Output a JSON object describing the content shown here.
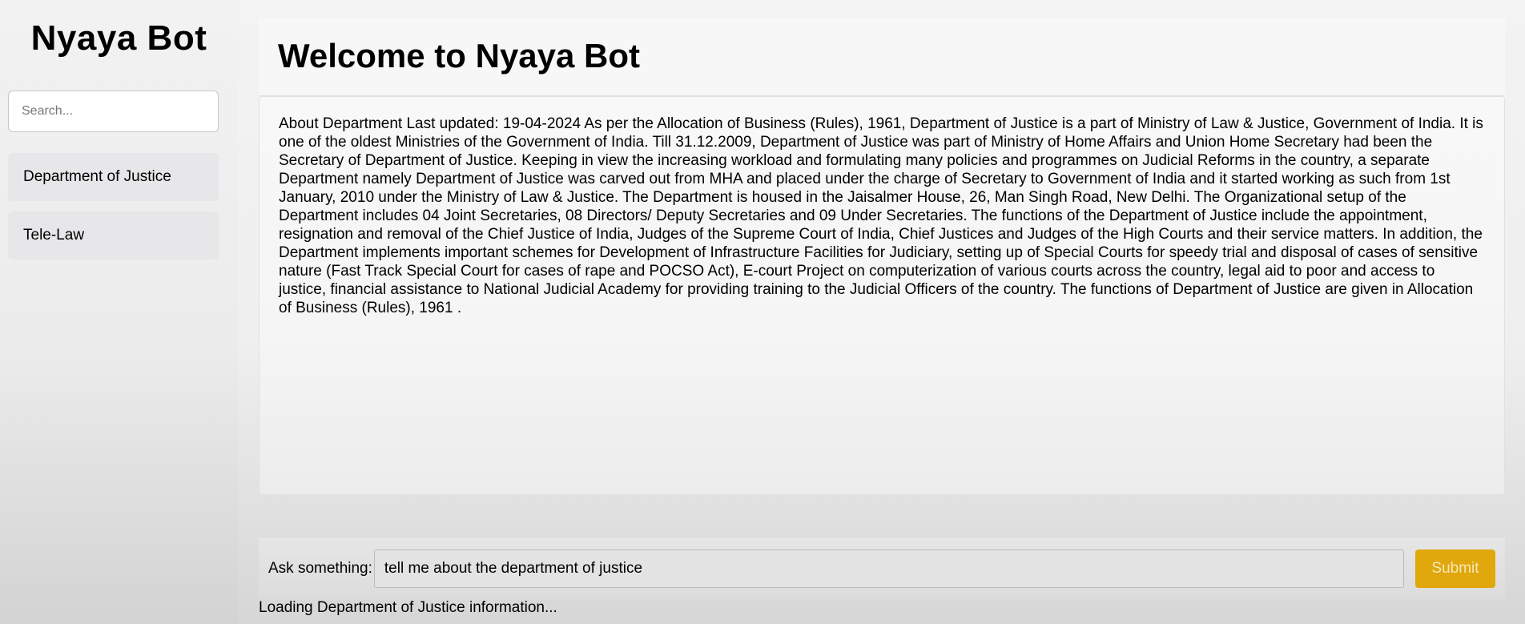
{
  "sidebar": {
    "title": "Nyaya Bot",
    "search_placeholder": "Search...",
    "items": [
      {
        "label": "Department of Justice"
      },
      {
        "label": "Tele-Law"
      }
    ]
  },
  "main": {
    "heading": "Welcome to Nyaya Bot",
    "content": "About Department Last updated: 19-04-2024 As per the Allocation of Business (Rules), 1961, Department of Justice is a part of Ministry of Law & Justice, Government of India. It is one of the oldest Ministries of the Government of India. Till 31.12.2009, Department of Justice was part of Ministry of Home Affairs and Union Home Secretary had been the Secretary of Department of Justice. Keeping in view the increasing workload and formulating many policies and programmes on Judicial Reforms in the country, a separate Department namely Department of Justice was carved out from MHA and placed under the charge of Secretary to Government of India and it started working as such from 1st January, 2010 under the Ministry of Law & Justice. The Department is housed in the Jaisalmer House, 26, Man Singh Road, New Delhi. The Organizational setup of the Department includes 04 Joint Secretaries, 08 Directors/ Deputy Secretaries and 09 Under Secretaries. The functions of the Department of Justice include the appointment, resignation and removal of the Chief Justice of India, Judges of the Supreme Court of India, Chief Justices and Judges of the High Courts and their service matters. In addition, the Department implements important schemes for Development of Infrastructure Facilities for Judiciary, setting up of Special Courts for speedy trial and disposal of cases of sensitive nature (Fast Track Special Court for cases of rape and POCSO Act), E-court Project on computerization of various courts across the country, legal aid to poor and access to justice, financial assistance to National Judicial Academy for providing training to the Judicial Officers of the country. The functions of Department of Justice are given in Allocation of Business (Rules), 1961 ."
  },
  "ask": {
    "label": "Ask something:",
    "value": "tell me about the department of justice",
    "submit_label": "Submit"
  },
  "status": "Loading Department of Justice information...",
  "colors": {
    "accent": "#e0a80c",
    "sidebar_item_bg": "#e7e7e9"
  }
}
